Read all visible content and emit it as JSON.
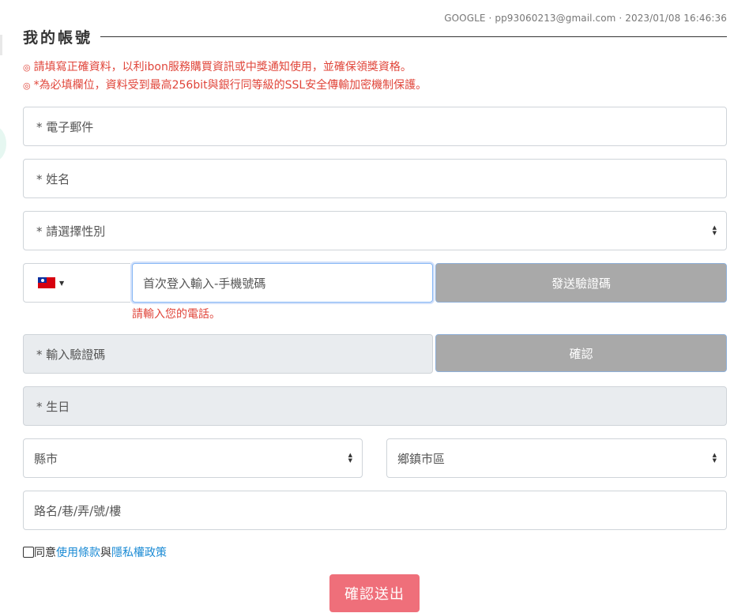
{
  "account": {
    "provider": "GOOGLE",
    "email": "pp93060213@gmail.com",
    "timestamp": "2023/01/08 16:46:36",
    "separator": "·"
  },
  "section": {
    "title": "我的帳號"
  },
  "notices": [
    {
      "bullet": "◎",
      "text": "請填寫正確資料，以利ibon服務購買資訊或中獎通知使用，並確保領獎資格。"
    },
    {
      "bullet": "◎",
      "text": "*為必填欄位，資料受到最高256bit與銀行同等級的SSL安全傳輸加密機制保護。"
    }
  ],
  "form": {
    "email_placeholder": "* 電子郵件",
    "name_placeholder": "* 姓名",
    "gender_placeholder": "* 請選擇性別",
    "phone_placeholder": "首次登入輸入-手機號碼",
    "send_code_label": "發送驗證碼",
    "phone_error": "請輸入您的電話。",
    "code_placeholder": "* 輸入驗證碼",
    "confirm_label": "確認",
    "birthday_placeholder": "* 生日",
    "city_placeholder": "縣市",
    "district_placeholder": "鄉鎮市區",
    "address_placeholder": "路名/巷/弄/號/樓",
    "caret_up": "▲",
    "caret_down": "▼",
    "flag_caret": "▼"
  },
  "agreement": {
    "prefix": "同意",
    "terms_link": "使用條款",
    "conjunction": "與",
    "privacy_link": "隱私權政策"
  },
  "submit": {
    "label": "確認送出"
  },
  "colors": {
    "error_red": "#e0453a",
    "link_blue": "#1a8ad4",
    "submit_pink": "#ef6f7a",
    "button_gray": "#a9a9a9",
    "disabled_bg": "#e9ecef"
  },
  "icons": {
    "flag": "taiwan-flag-icon",
    "caret": "sort-caret-icon",
    "bullet": "circle-bullet-icon"
  }
}
